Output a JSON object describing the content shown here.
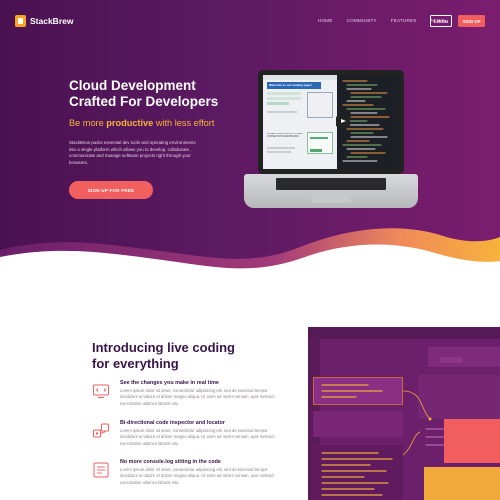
{
  "nav": {
    "brand": "StackBrew",
    "links": [
      "HOME",
      "COMMUNITY",
      "FEATURES",
      "NEWS"
    ],
    "login": "LOGIN",
    "signup": "SIGN UP"
  },
  "hero": {
    "title_line1": "Cloud Development",
    "title_line2": "Crafted For Developers",
    "tagline_prefix": "Be more",
    "tagline_bold": "productive",
    "tagline_suffix": "with less effort",
    "description": "StackBrew packs essential dev tools and operating environments into a single platform which allows you to develop, collaborate , communicate and manage software projects right through your browsers.",
    "cta": "SIGN UP FOR FREE",
    "screen_heading": "Welcome to our landing page!",
    "screen_subheading": "LOREM IPSUM DOLOR SIT AMET, CONSECTETUR ADIPISICING"
  },
  "features": {
    "title_line1": "Introducing live coding",
    "title_line2": "for everything",
    "items": [
      {
        "title": "See the changes you make in real time",
        "icon": "monitor-code-icon",
        "desc": "Lorem ipsum dolor sit amet, consectetur adipisicing elit, sed do eiusmod tempor incididunt ut labore et dolore magna aliqua. Ut enim ad minim veniam, quis nostrud exercitation ullamco laboris nisi."
      },
      {
        "title": "Bi-directional code inspector and locator",
        "icon": "inspector-icon",
        "desc": "Lorem ipsum dolor sit amet, consectetur adipisicing elit, sed do eiusmod tempor incididunt ut labore et dolore magna aliqua. Ut enim ad minim veniam, quis nostrud exercitation ullamco laboris nisi."
      },
      {
        "title": "No more console.log sitting in the code",
        "icon": "console-list-icon",
        "desc": "Lorem ipsum dolor sit amet, consectetur adipisicing elit, sed do eiusmod tempor incididunt ut labore et dolore magna aliqua. Ut enim ad minim veniam, quis nostrud exercitation ullamco laboris nisi."
      }
    ]
  },
  "colors": {
    "hero_bg": "#5c1a62",
    "accent_orange": "#f7b23b",
    "cta_red": "#f15f5f",
    "heading_dark": "#3a1449",
    "editor_bg": "#6c1f6a"
  }
}
